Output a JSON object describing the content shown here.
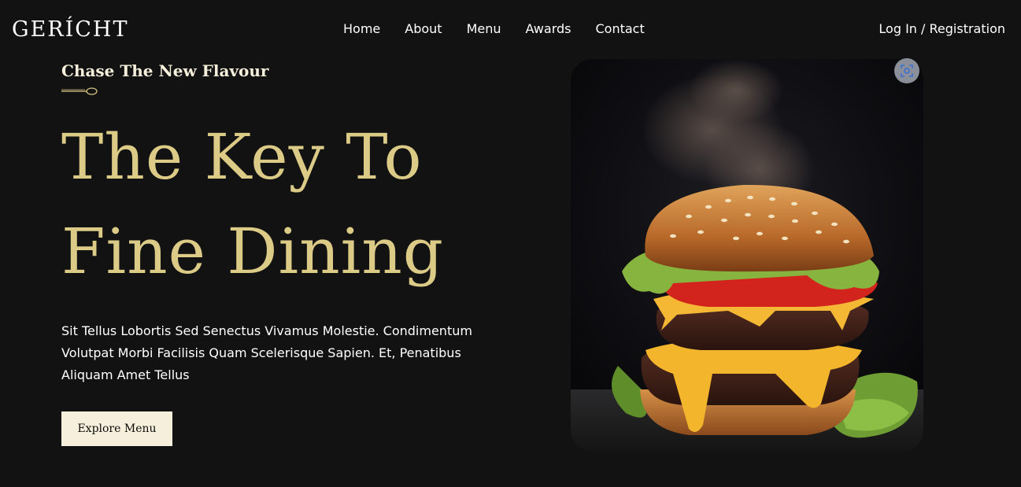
{
  "brand": {
    "logo": "GERÍCHT"
  },
  "nav": {
    "items": [
      {
        "label": "Home"
      },
      {
        "label": "About"
      },
      {
        "label": "Menu"
      },
      {
        "label": "Awards"
      },
      {
        "label": "Contact"
      }
    ],
    "login_label": "Log In / Registration"
  },
  "hero": {
    "subtitle": "Chase The New Flavour",
    "title_line1": "The Key To",
    "title_line2": "Fine Dining",
    "description": "Sit Tellus Lobortis Sed Senectus Vivamus Molestie. Condimentum Volutpat Morbi Facilisis Quam Scelerisque Sapien. Et, Penatibus Aliquam Amet Tellus",
    "button_label": "Explore Menu",
    "image_icon": "burger-photo",
    "lens_icon": "visual-search-icon"
  },
  "colors": {
    "background": "#121212",
    "gold": "#dcca87",
    "cream": "#f5efdb",
    "white": "#ffffff"
  }
}
